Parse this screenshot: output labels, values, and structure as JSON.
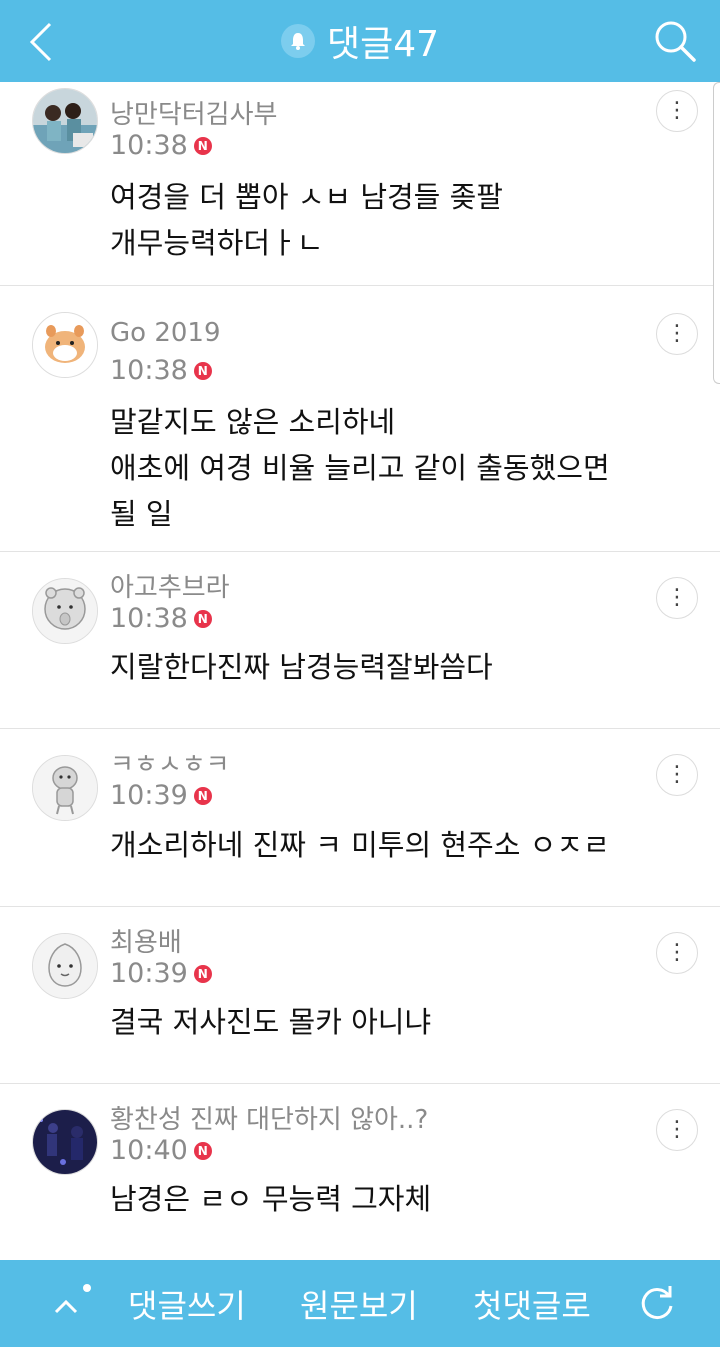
{
  "header": {
    "title": "댓글47"
  },
  "comments": [
    {
      "nickname": "낭만닥터김사부",
      "time": "10:38",
      "badge": "N",
      "lines": [
        "여경을 더 뽑아 ㅅㅂ 남경들 좆팔",
        "개무능력하더ㅏㄴ"
      ]
    },
    {
      "nickname": "Go 2019",
      "time": "10:38",
      "badge": "N",
      "lines": [
        "말같지도 않은 소리하네",
        "애초에 여경 비율 늘리고 같이 출동했으면",
        "될 일"
      ]
    },
    {
      "nickname": "아고추브라",
      "time": "10:38",
      "badge": "N",
      "lines": [
        "지랄한다진짜 남경능력잘봐씀다"
      ]
    },
    {
      "nickname": "ㅋㅎㅅㅎㅋ",
      "time": "10:39",
      "badge": "N",
      "lines": [
        "개소리하네 진짜 ㅋ 미투의 현주소 ㅇㅈㄹ"
      ]
    },
    {
      "nickname": "최용배",
      "time": "10:39",
      "badge": "N",
      "lines": [
        "결국 저사진도 몰카 아니냐"
      ]
    },
    {
      "nickname": "황찬성 진짜 대단하지 않아..?",
      "time": "10:40",
      "badge": "N",
      "lines": [
        "남경은 ㄹㅇ 무능력 그자체"
      ]
    }
  ],
  "footer": {
    "write": "댓글쓰기",
    "original": "원문보기",
    "first": "첫댓글로"
  },
  "icons": {
    "back": "chevron-left-icon",
    "search": "search-icon",
    "bell": "bell-icon",
    "more": "more-vertical-icon",
    "up": "chevron-up-icon",
    "refresh": "refresh-icon"
  },
  "colors": {
    "bar": "#55bde6",
    "badge": "#e8344b"
  }
}
